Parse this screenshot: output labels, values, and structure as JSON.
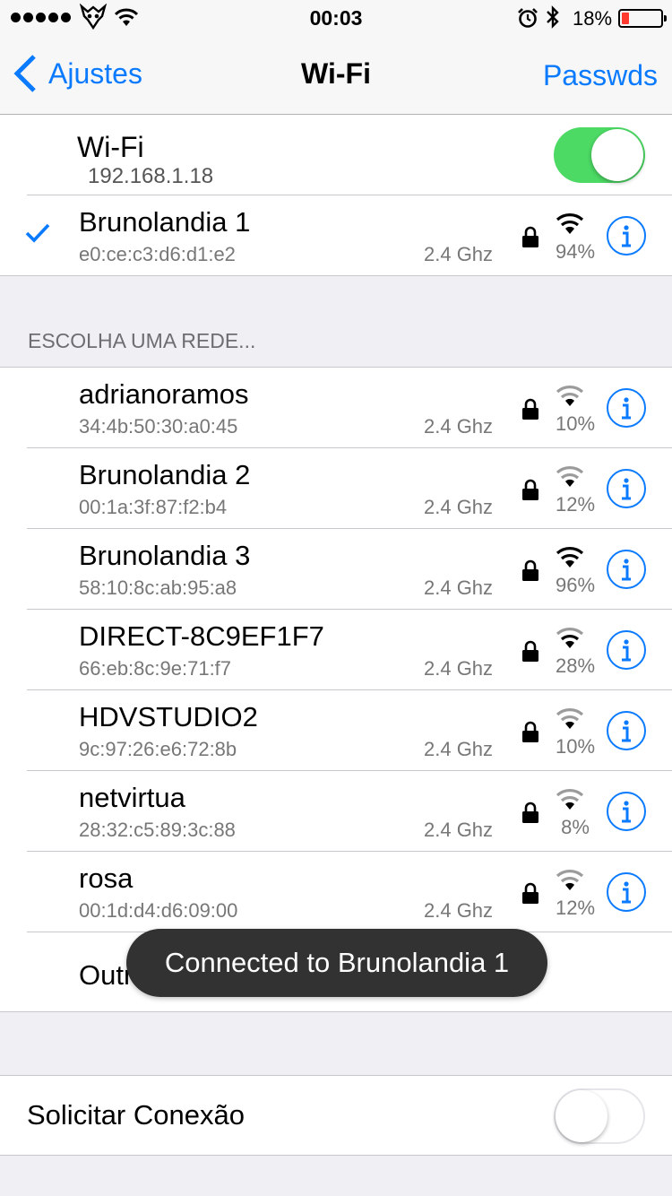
{
  "status_bar": {
    "time": "00:03",
    "battery_percent": "18%",
    "battery_level": 0.18
  },
  "nav": {
    "back_label": "Ajustes",
    "title": "Wi-Fi",
    "right_label": "Passwds"
  },
  "wifi": {
    "label": "Wi-Fi",
    "ip": "192.168.1.18",
    "enabled": true
  },
  "connected": {
    "name": "Brunolandia 1",
    "mac": "e0:ce:c3:d6:d1:e2",
    "band": "2.4 Ghz",
    "signal": "94%"
  },
  "section_header": "ESCOLHA UMA REDE...",
  "networks": [
    {
      "name": "adrianoramos",
      "mac": "34:4b:50:30:a0:45",
      "band": "2.4 Ghz",
      "signal": "10%"
    },
    {
      "name": "Brunolandia 2",
      "mac": "00:1a:3f:87:f2:b4",
      "band": "2.4 Ghz",
      "signal": "12%"
    },
    {
      "name": "Brunolandia 3",
      "mac": "58:10:8c:ab:95:a8",
      "band": "2.4 Ghz",
      "signal": "96%"
    },
    {
      "name": "DIRECT-8C9EF1F7",
      "mac": "66:eb:8c:9e:71:f7",
      "band": "2.4 Ghz",
      "signal": "28%"
    },
    {
      "name": "HDVSTUDIO2",
      "mac": "9c:97:26:e6:72:8b",
      "band": "2.4 Ghz",
      "signal": "10%"
    },
    {
      "name": "netvirtua",
      "mac": "28:32:c5:89:3c:88",
      "band": "2.4 Ghz",
      "signal": "8%"
    },
    {
      "name": "rosa",
      "mac": "00:1d:d4:d6:09:00",
      "band": "2.4 Ghz",
      "signal": "12%"
    }
  ],
  "other_label": "Outra...",
  "ask_to_join": {
    "label": "Solicitar Conexão",
    "enabled": false
  },
  "toast": "Connected to Brunolandia 1",
  "colors": {
    "accent": "#0a7aff",
    "toggle_on": "#4cd964",
    "battery_low": "#ff3b30",
    "toast_bg": "#323232"
  }
}
